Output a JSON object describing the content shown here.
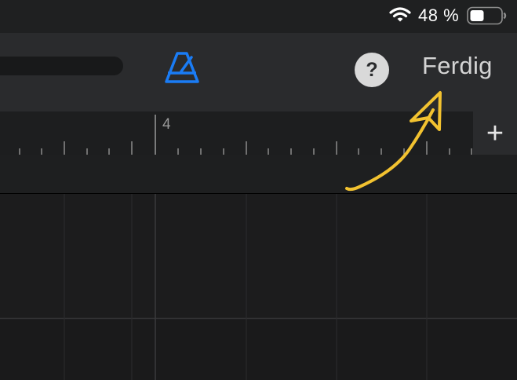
{
  "status_bar": {
    "battery_percent": "48 %",
    "battery_level": 0.48,
    "icons": [
      "wifi-icon",
      "battery-icon"
    ]
  },
  "toolbar": {
    "metronome_icon": "metronome-icon",
    "metronome_color": "#1a7cf5",
    "help_label": "?",
    "done_label": "Ferdig"
  },
  "ruler": {
    "bar_label": "4",
    "add_label": "+"
  },
  "annotation": {
    "color": "#f2c230"
  }
}
